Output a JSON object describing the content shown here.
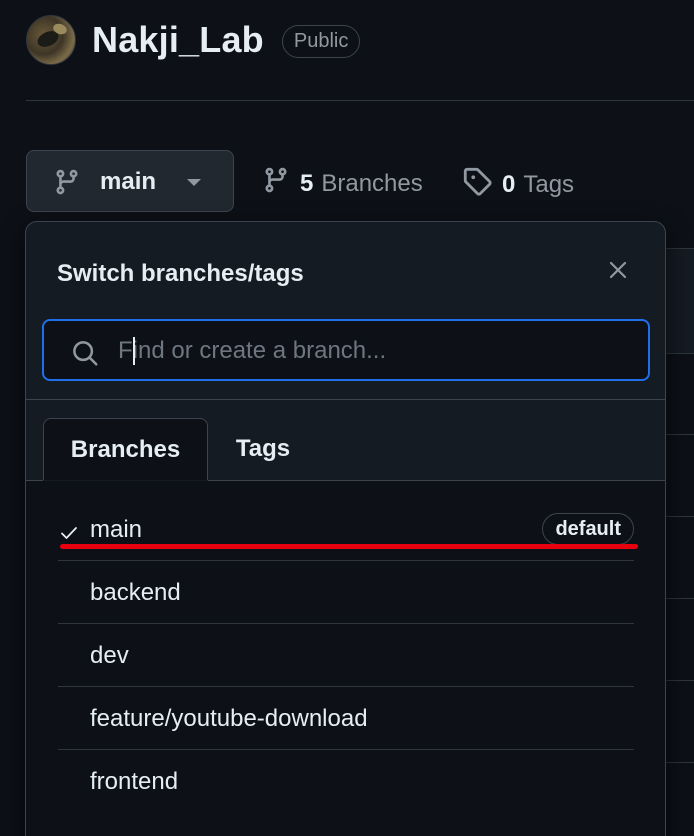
{
  "repo": {
    "name": "Nakji_Lab",
    "visibility": "Public"
  },
  "branch_bar": {
    "current_branch": "main",
    "branches_count": "5",
    "branches_label": "Branches",
    "tags_count": "0",
    "tags_label": "Tags"
  },
  "dropdown": {
    "title": "Switch branches/tags",
    "search_placeholder": "Find or create a branch...",
    "search_value": "",
    "tabs": [
      {
        "label": "Branches",
        "active": true
      },
      {
        "label": "Tags",
        "active": false
      }
    ],
    "branches": [
      {
        "name": "main",
        "checked": true,
        "badge": "default"
      },
      {
        "name": "backend",
        "checked": false,
        "badge": ""
      },
      {
        "name": "dev",
        "checked": false,
        "badge": ""
      },
      {
        "name": "feature/youtube-download",
        "checked": false,
        "badge": ""
      },
      {
        "name": "frontend",
        "checked": false,
        "badge": ""
      }
    ]
  },
  "annotation": {
    "color": "#e8000f",
    "target": "main"
  },
  "colors": {
    "background": "#0d1117",
    "accent_focus": "#1f6feb",
    "text": "#e6edf3",
    "muted": "#9198a1"
  },
  "icons": [
    "git-branch-icon",
    "caret-down-icon",
    "tag-icon",
    "close-icon",
    "search-icon",
    "check-icon"
  ]
}
